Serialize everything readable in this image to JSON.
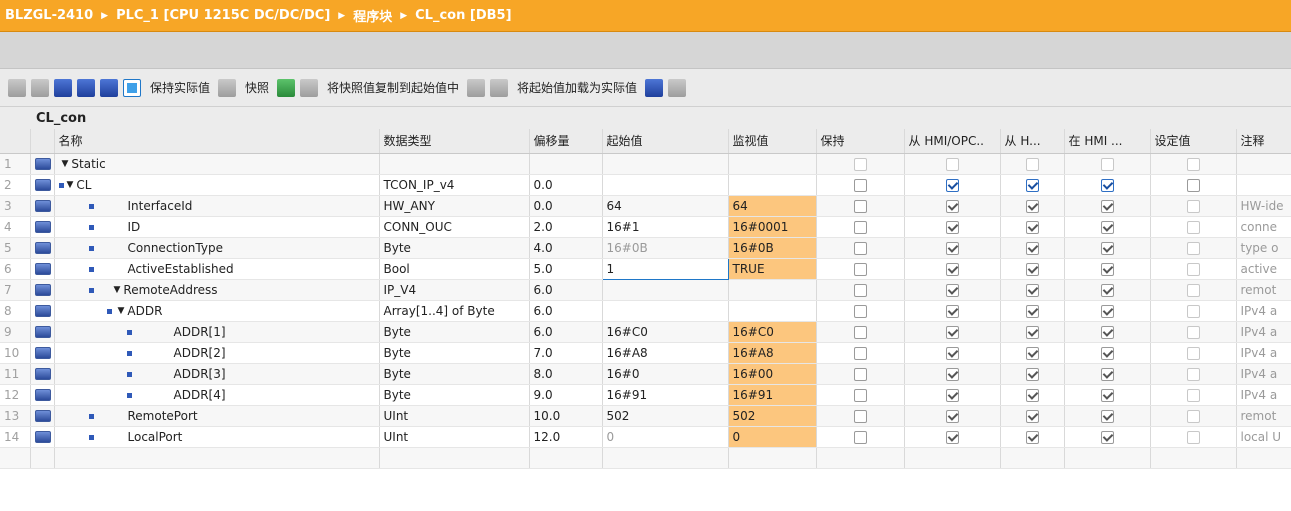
{
  "breadcrumb": [
    "BLZGL-2410",
    "PLC_1 [CPU 1215C DC/DC/DC]",
    "程序块",
    "CL_con [DB5]"
  ],
  "toolbar": {
    "keep_actual": "保持实际值",
    "snapshot": "快照",
    "copy_snapshot": "将快照值复制到起始值中",
    "load_start": "将起始值加载为实际值"
  },
  "block_name": "CL_con",
  "columns": [
    "名称",
    "数据类型",
    "偏移量",
    "起始值",
    "监视值",
    "保持",
    "从 HMI/OPC..",
    "从 H...",
    "在 HMI ...",
    "设定值",
    "注释"
  ],
  "rows": [
    {
      "num": "1",
      "name": "Static",
      "type": "",
      "offset": "",
      "start": "",
      "monitor": "",
      "comment": ""
    },
    {
      "num": "2",
      "name": "CL",
      "type": "TCON_IP_v4",
      "offset": "0.0",
      "start": "",
      "monitor": "",
      "comment": ""
    },
    {
      "num": "3",
      "name": "InterfaceId",
      "type": "HW_ANY",
      "offset": "0.0",
      "start": "64",
      "monitor": "64",
      "comment": "HW-ide"
    },
    {
      "num": "4",
      "name": "ID",
      "type": "CONN_OUC",
      "offset": "2.0",
      "start": "16#1",
      "monitor": "16#0001",
      "comment": "conne"
    },
    {
      "num": "5",
      "name": "ConnectionType",
      "type": "Byte",
      "offset": "4.0",
      "start": "16#0B",
      "monitor": "16#0B",
      "comment": "type o"
    },
    {
      "num": "6",
      "name": "ActiveEstablished",
      "type": "Bool",
      "offset": "5.0",
      "start": "1",
      "monitor": "TRUE",
      "comment": "active"
    },
    {
      "num": "7",
      "name": "RemoteAddress",
      "type": "IP_V4",
      "offset": "6.0",
      "start": "",
      "monitor": "",
      "comment": "remot"
    },
    {
      "num": "8",
      "name": "ADDR",
      "type": "Array[1..4] of Byte",
      "offset": "6.0",
      "start": "",
      "monitor": "",
      "comment": "IPv4 a"
    },
    {
      "num": "9",
      "name": "ADDR[1]",
      "type": "Byte",
      "offset": "6.0",
      "start": "16#C0",
      "monitor": "16#C0",
      "comment": "IPv4 a"
    },
    {
      "num": "10",
      "name": "ADDR[2]",
      "type": "Byte",
      "offset": "7.0",
      "start": "16#A8",
      "monitor": "16#A8",
      "comment": "IPv4 a"
    },
    {
      "num": "11",
      "name": "ADDR[3]",
      "type": "Byte",
      "offset": "8.0",
      "start": "16#0",
      "monitor": "16#00",
      "comment": "IPv4 a"
    },
    {
      "num": "12",
      "name": "ADDR[4]",
      "type": "Byte",
      "offset": "9.0",
      "start": "16#91",
      "monitor": "16#91",
      "comment": "IPv4 a"
    },
    {
      "num": "13",
      "name": "RemotePort",
      "type": "UInt",
      "offset": "10.0",
      "start": "502",
      "monitor": "502",
      "comment": "remot"
    },
    {
      "num": "14",
      "name": "LocalPort",
      "type": "UInt",
      "offset": "12.0",
      "start": "0",
      "monitor": "0",
      "comment": "local U"
    }
  ],
  "colors": {
    "title_bar": "#f7a626",
    "monitor_cell": "#fcc67e"
  }
}
